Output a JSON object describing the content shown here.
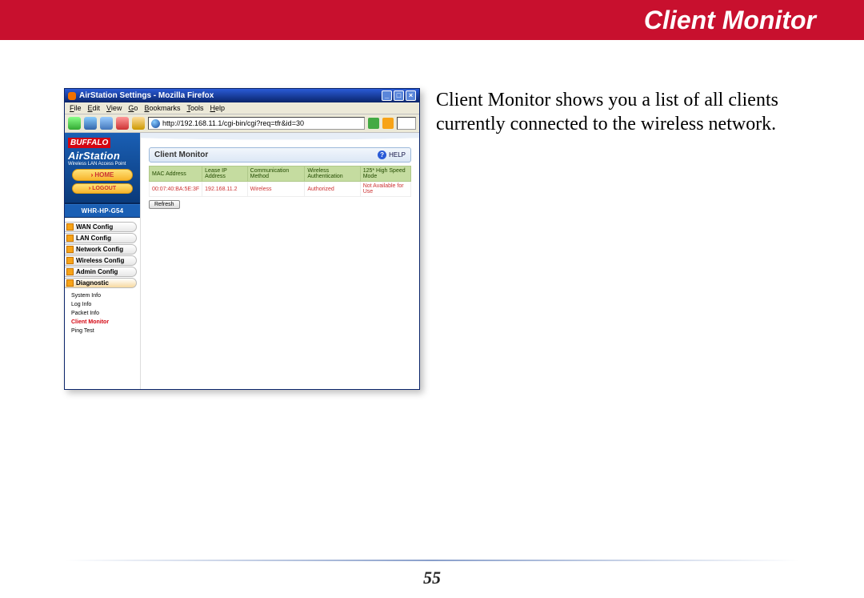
{
  "banner_title": "Client Monitor",
  "description": "Client Monitor shows you a list of all clients currently connected to the wireless network.",
  "page_number": "55",
  "browser": {
    "window_title": "AirStation Settings - Mozilla Firefox",
    "menus": [
      "File",
      "Edit",
      "View",
      "Go",
      "Bookmarks",
      "Tools",
      "Help"
    ],
    "url": "http://192.168.11.1/cgi-bin/cgi?req=tfr&id=30"
  },
  "sidebar": {
    "brand_top": "BUFFALO",
    "brand_main": "AirStation",
    "brand_sub": "Wireless LAN Access Point",
    "home_label": "HOME",
    "logout_label": "LOGOUT",
    "model": "WHR-HP-G54",
    "tabs": [
      "WAN Config",
      "LAN Config",
      "Network Config",
      "Wireless Config",
      "Admin Config",
      "Diagnostic"
    ],
    "subitems": [
      "System Info",
      "Log Info",
      "Packet Info",
      "Client Monitor",
      "Ping Test"
    ]
  },
  "panel": {
    "title": "Client Monitor",
    "help": "HELP",
    "headers": [
      "MAC Address",
      "Lease IP Address",
      "Communication Method",
      "Wireless Authentication",
      "125* High Speed Mode"
    ],
    "row": [
      "00:07:40:BA:5E:3F",
      "192.168.11.2",
      "Wireless",
      "Authorized",
      "Not Available for Use"
    ],
    "refresh": "Refresh"
  }
}
